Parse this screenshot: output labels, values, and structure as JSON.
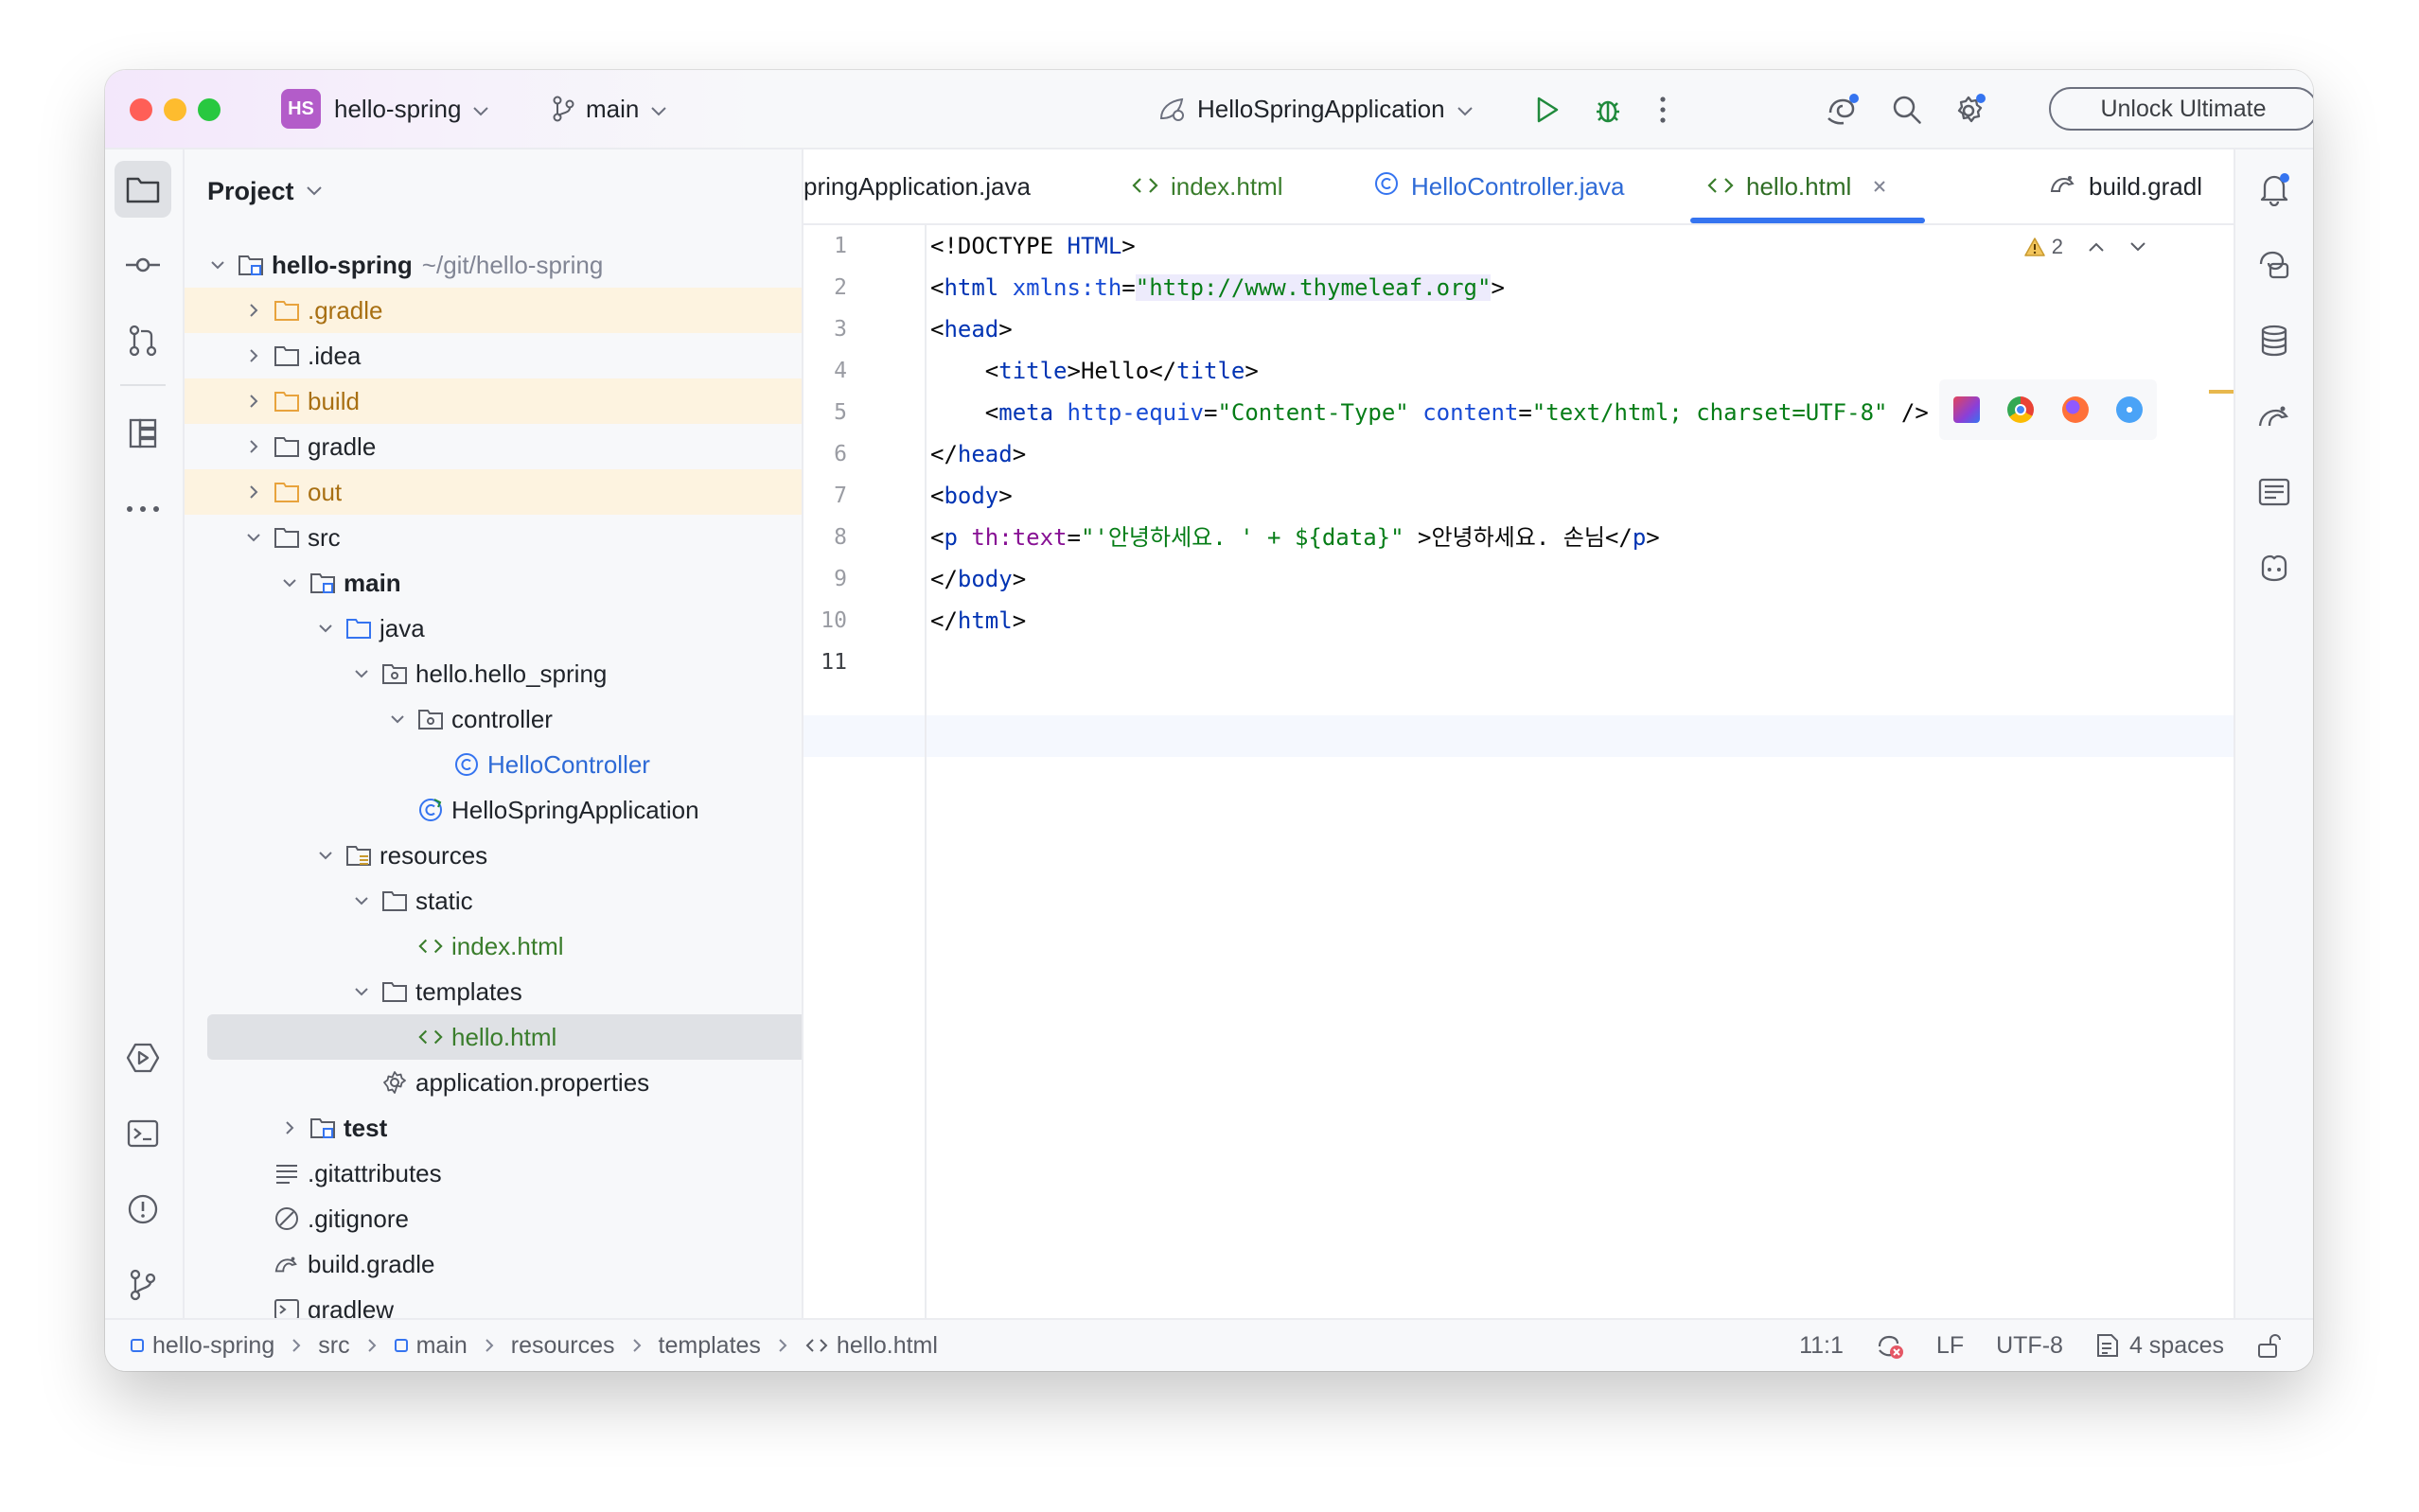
{
  "titlebar": {
    "project_badge": "HS",
    "project_name": "hello-spring",
    "branch": "main",
    "run_config": "HelloSpringApplication",
    "unlock_label": "Unlock Ultimate"
  },
  "project_panel": {
    "title": "Project",
    "root_name": "hello-spring",
    "root_path": "~/git/hello-spring",
    "items": [
      {
        "label": ".gradle"
      },
      {
        "label": ".idea"
      },
      {
        "label": "build"
      },
      {
        "label": "gradle"
      },
      {
        "label": "out"
      },
      {
        "label": "src"
      },
      {
        "label": "main"
      },
      {
        "label": "java"
      },
      {
        "label": "hello.hello_spring"
      },
      {
        "label": "controller"
      },
      {
        "label": "HelloController"
      },
      {
        "label": "HelloSpringApplication"
      },
      {
        "label": "resources"
      },
      {
        "label": "static"
      },
      {
        "label": "index.html"
      },
      {
        "label": "templates"
      },
      {
        "label": "hello.html"
      },
      {
        "label": "application.properties"
      },
      {
        "label": "test"
      },
      {
        "label": ".gitattributes"
      },
      {
        "label": ".gitignore"
      },
      {
        "label": "build.gradle"
      },
      {
        "label": "gradlew"
      }
    ]
  },
  "tabs": [
    {
      "label": "pringApplication.java"
    },
    {
      "label": "index.html"
    },
    {
      "label": "HelloController.java"
    },
    {
      "label": "hello.html"
    },
    {
      "label": "build.gradl"
    }
  ],
  "editor": {
    "warning_count": "2",
    "line_numbers": [
      "1",
      "2",
      "3",
      "4",
      "5",
      "6",
      "7",
      "8",
      "9",
      "10",
      "11"
    ],
    "code": {
      "l1a": "<!DOCTYPE ",
      "l1b": "HTML",
      "l1c": ">",
      "l2a": "<",
      "l2b": "html",
      "l2c": " xmlns:th",
      "l2d": "=",
      "l2e": "\"http://www.thymeleaf.org\"",
      "l2f": ">",
      "l3a": "<",
      "l3b": "head",
      "l3c": ">",
      "l4a": "    <",
      "l4b": "title",
      "l4c": ">Hello</",
      "l4d": "title",
      "l4e": ">",
      "l5a": "    <",
      "l5b": "meta",
      "l5c": " http-equiv",
      "l5d": "=",
      "l5e": "\"Content-Type\"",
      "l5f": " content",
      "l5g": "=",
      "l5h": "\"text/html; charset=UTF-8\"",
      "l5i": " />",
      "l6a": "</",
      "l6b": "head",
      "l6c": ">",
      "l7a": "<",
      "l7b": "body",
      "l7c": ">",
      "l8a": "<",
      "l8b": "p",
      "l8c": " th:text",
      "l8d": "=",
      "l8e": "\"'안녕하세요. ' + ${data}\"",
      "l8f": " >안녕하세요. 손님</",
      "l8g": "p",
      "l8h": ">",
      "l9a": "</",
      "l9b": "body",
      "l9c": ">",
      "l10a": "</",
      "l10b": "html",
      "l10c": ">"
    }
  },
  "statusbar": {
    "breadcrumbs": [
      "hello-spring",
      "src",
      "main",
      "resources",
      "templates",
      "hello.html"
    ],
    "position": "11:1",
    "line_sep": "LF",
    "encoding": "UTF-8",
    "indent": "4 spaces"
  },
  "colors": {
    "accent": "#3574f0",
    "badge": "#b35cc9",
    "highlight_row": "#fdf3e0",
    "folder_excluded": "#e8a33d"
  }
}
